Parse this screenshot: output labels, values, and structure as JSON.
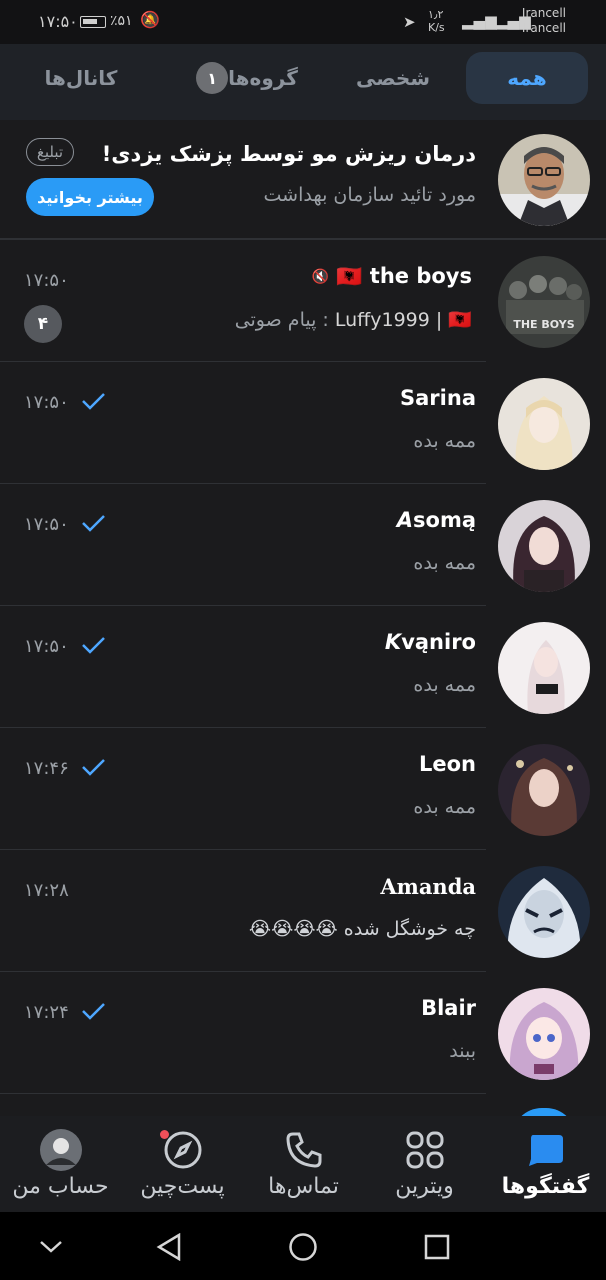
{
  "status_bar": {
    "time": "۱۷:۵۰",
    "battery": "٪۵۱",
    "net_speed": "۱٫۲",
    "net_unit": "K/s",
    "carrier1": "Irancell",
    "carrier2": "Irancell",
    "signal_label": "4G"
  },
  "tabs": [
    {
      "label": "همه",
      "active": true
    },
    {
      "label": "شخصی",
      "active": false
    },
    {
      "label": "گروه‌ها",
      "badge": "۱",
      "active": false
    },
    {
      "label": "کانال‌ها",
      "active": false
    }
  ],
  "ad": {
    "title": "درمان ریزش مو توسط پزشک یزدی!",
    "subtitle": "مورد تائید سازمان بهداشت",
    "tag": "تبلیغ",
    "button": "بیشتر بخوانید"
  },
  "chats": [
    {
      "name": "the boys",
      "sender": "Luffy1999 | 🇦🇱",
      "message": ": پیام صوتی",
      "time": "۱۷:۵۰",
      "unread": "۴",
      "read": false,
      "muted": true
    },
    {
      "name": "Sarina",
      "message": "ممه بده",
      "time": "۱۷:۵۰",
      "read": true
    },
    {
      "name": "𝘼somą",
      "message": "ممه بده",
      "time": "۱۷:۵۰",
      "read": true
    },
    {
      "name": "𝙆vąniro",
      "message": "ممه بده",
      "time": "۱۷:۵۰",
      "read": true
    },
    {
      "name": "Leon",
      "message": "ممه بده",
      "time": "۱۷:۴۶",
      "read": true
    },
    {
      "name": "Amanda",
      "message": "چه خوشگل شده 😭😭😭😭",
      "time": "۱۷:۲۸",
      "read": false
    },
    {
      "name": "Blair",
      "message": "ببند",
      "time": "۱۷:۲۴",
      "read": true
    }
  ],
  "bottom_nav": [
    {
      "label": "گفتگوها",
      "icon": "chat-bubble-icon",
      "active": true
    },
    {
      "label": "ویترین",
      "icon": "grid-icon"
    },
    {
      "label": "تماس‌ها",
      "icon": "phone-icon"
    },
    {
      "label": "پست‌چین",
      "icon": "compass-icon"
    },
    {
      "label": "حساب من",
      "icon": "profile-avatar"
    }
  ],
  "colors": {
    "background": "#1b1b1d",
    "accent": "#4ea7ff",
    "button_blue": "#2a9bf6"
  }
}
